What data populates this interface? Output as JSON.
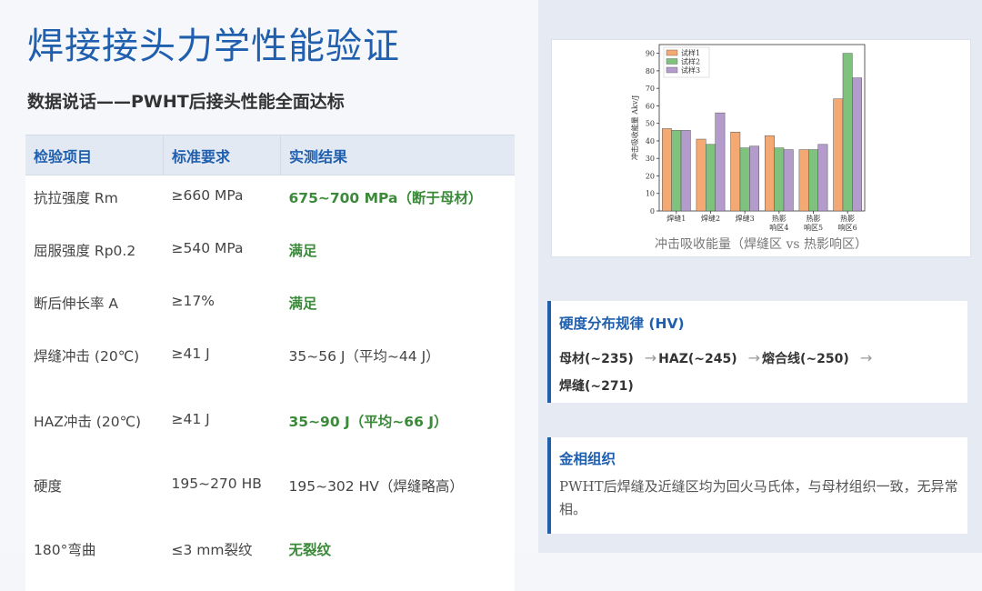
{
  "page": {
    "title": "焊接接头力学性能验证",
    "subtitle": "数据说话——PWHT后接头性能全面达标"
  },
  "table": {
    "headers": [
      "检验项目",
      "标准要求",
      "实测结果"
    ],
    "rows": [
      {
        "item": "抗拉强度 Rm",
        "req": "≥660 MPa",
        "result": "675~700 MPa（断于母材）",
        "good": true
      },
      {
        "item": "屈服强度 Rp0.2",
        "req": "≥540 MPa",
        "result": "满足",
        "good": true
      },
      {
        "item": "断后伸长率 A",
        "req": "≥17%",
        "result": "满足",
        "good": true
      },
      {
        "item": "焊缝冲击 (20℃)",
        "req": "≥41 J",
        "result": "35~56 J（平均~44 J）",
        "good": false
      },
      {
        "item": "HAZ冲击 (20℃)",
        "req": "≥41 J",
        "result": "35~90 J（平均~66 J）",
        "good": true
      },
      {
        "item": "硬度",
        "req": "195~270 HB",
        "result": "195~302 HV（焊缝略高）",
        "good": false
      },
      {
        "item": "180°弯曲",
        "req": "≤3 mm裂纹",
        "result": "无裂纹",
        "good": true
      }
    ]
  },
  "chart_caption": "冲击吸收能量（焊缝区 vs 热影响区）",
  "chart_data": {
    "type": "bar",
    "categories": [
      [
        "焊缝1"
      ],
      [
        "焊缝2"
      ],
      [
        "焊缝3"
      ],
      [
        "热影",
        "响区4"
      ],
      [
        "热影",
        "响区5"
      ],
      [
        "热影",
        "响区6"
      ]
    ],
    "series": [
      {
        "name": "试样1",
        "color": "#f4a872",
        "values": [
          47,
          41,
          45,
          43,
          35,
          64
        ]
      },
      {
        "name": "试样2",
        "color": "#7ec27e",
        "values": [
          46,
          38,
          36,
          36,
          35,
          90
        ]
      },
      {
        "name": "试样3",
        "color": "#b39bcc",
        "values": [
          46,
          56,
          37,
          35,
          38,
          76
        ]
      }
    ],
    "ylabel": "冲击吸收能量 Akv/J",
    "ylim": [
      0,
      95
    ],
    "yticks": [
      0,
      10,
      20,
      30,
      40,
      50,
      60,
      70,
      80,
      90
    ],
    "legend_position": "top-left"
  },
  "hardness": {
    "title": "硬度分布规律 (HV)",
    "steps": [
      "母材(~235)",
      "HAZ(~245)",
      "熔合线(~250)",
      "焊缝(~271)"
    ],
    "arrow": "→"
  },
  "microstructure": {
    "title": "金相组织",
    "text": "PWHT后焊缝及近缝区均为回火马氏体，与母材组织一致，无异常相。"
  }
}
